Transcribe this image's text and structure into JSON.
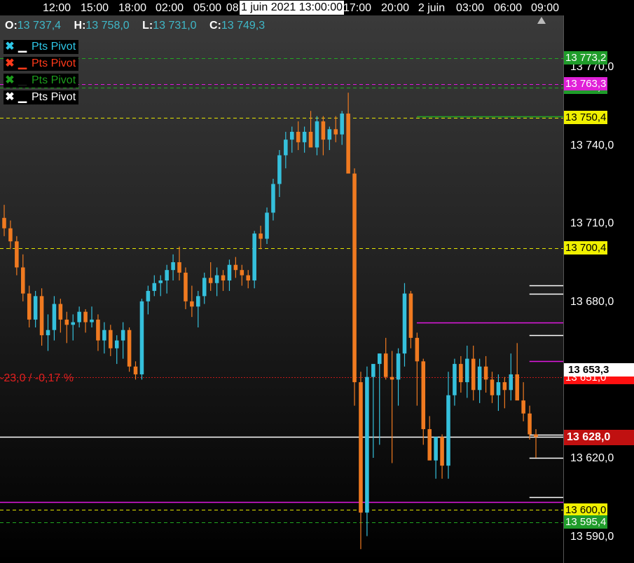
{
  "time_axis": {
    "labels": [
      "12:00",
      "15:00",
      "18:00",
      "02:00",
      "05:00",
      "08:",
      "17:00",
      "20:00",
      "2 juin",
      "03:00",
      "06:00",
      "09:00"
    ],
    "cursor_label": "1 juin 2021 13:00:00"
  },
  "ohlc": {
    "o_label": "O:",
    "o_value": "13 737,4",
    "h_label": "H:",
    "h_value": "13 758,0",
    "l_label": "L:",
    "l_value": "13 731,0",
    "c_label": "C:",
    "c_value": "13 749,3"
  },
  "legend": [
    {
      "label": "Pts Pivot",
      "color": "#2ec8e8"
    },
    {
      "label": "Pts Pivot",
      "color": "#ff3a1a"
    },
    {
      "label": "Pts Pivot",
      "color": "#1c9c1c"
    },
    {
      "label": "Pts Pivot",
      "color": "#ffffff"
    }
  ],
  "change_label": "-23,0 / -0,17 %",
  "colors": {
    "up": "#35c0dc",
    "down": "#f07a20",
    "pivot_green": "#22a822",
    "pivot_yellow": "#e6e600",
    "pivot_magenta": "#e018e0",
    "change_red": "#e02020"
  },
  "price_axis": {
    "labels": [
      "13 770,0",
      "13 740,0",
      "13 710,0",
      "13 680,0",
      "13 620,0",
      "13 590,0"
    ],
    "tags": [
      {
        "text": "13 773,2",
        "bg": "#1f9c2a",
        "fg": "#ffffff",
        "price": 13773.2
      },
      {
        "text": "13 763,3",
        "bg": "#e020d8",
        "fg": "#ffffff",
        "price": 13763.3
      },
      {
        "text": "13 762,0",
        "bg": "#1f9c2a",
        "fg": "#ffffff",
        "price": 13762.0
      },
      {
        "text": "13 750,4",
        "bg": "#f0f000",
        "fg": "#000000",
        "price": 13750.4
      },
      {
        "text": "13 700,4",
        "bg": "#f0f000",
        "fg": "#000000",
        "price": 13700.4
      },
      {
        "text": "13 653,3",
        "bg": "#ffffff",
        "fg": "#000000",
        "price": 13653.3
      },
      {
        "text": "13 651,0",
        "bg": "#ff1010",
        "fg": "#ffffff",
        "price": 13651.0
      },
      {
        "text": "13 628,0",
        "bg": "#c01010",
        "fg": "#ffffff",
        "price": 13628.0
      },
      {
        "text": "13 600,0",
        "bg": "#f0f000",
        "fg": "#000000",
        "price": 13600.0
      },
      {
        "text": "13 595,4",
        "bg": "#1f9c2a",
        "fg": "#ffffff",
        "price": 13595.4
      }
    ]
  },
  "chart_data": {
    "type": "candlestick",
    "title": "",
    "ylim": [
      13587,
      13790
    ],
    "levels": [
      {
        "price": 13773.2,
        "color": "#22a822",
        "style": "dashed"
      },
      {
        "price": 13763.3,
        "color": "#e018e0",
        "style": "dashed"
      },
      {
        "price": 13762.0,
        "color": "#22a822",
        "style": "dashed"
      },
      {
        "price": 13750.4,
        "color": "#e6e600",
        "style": "dashed"
      },
      {
        "price": 13700.4,
        "color": "#e6e600",
        "style": "dashed"
      },
      {
        "price": 13651.0,
        "color": "#c01818",
        "style": "dotted"
      },
      {
        "price": 13628.0,
        "color": "#ffffff",
        "style": "solid"
      },
      {
        "price": 13603.0,
        "color": "#e018e0",
        "style": "solid"
      },
      {
        "price": 13600.0,
        "color": "#e6e600",
        "style": "dashed"
      },
      {
        "price": 13595.4,
        "color": "#22a822",
        "style": "dashed"
      }
    ],
    "segments": [
      {
        "price": 13751.0,
        "from": 0.74,
        "to": 1.0,
        "color": "#22a822"
      },
      {
        "price": 13672.0,
        "from": 0.74,
        "to": 1.0,
        "color": "#e018e0"
      },
      {
        "price": 13683.0,
        "from": 0.94,
        "to": 1.0,
        "color": "#ffffff"
      },
      {
        "price": 13657.0,
        "from": 0.94,
        "to": 1.0,
        "color": "#e018e0"
      },
      {
        "price": 13605.0,
        "from": 0.94,
        "to": 1.0,
        "color": "#ffffff"
      },
      {
        "price": 13686.0,
        "from": 0.94,
        "to": 1.0,
        "color": "#ffffff"
      },
      {
        "price": 13667.0,
        "from": 0.94,
        "to": 1.0,
        "color": "#ffffff"
      },
      {
        "price": 13629.0,
        "from": 0.94,
        "to": 1.0,
        "color": "#ffffff"
      },
      {
        "price": 13620.0,
        "from": 0.94,
        "to": 1.0,
        "color": "#ffffff"
      }
    ],
    "candles": [
      [
        13712,
        13717,
        13705,
        13708
      ],
      [
        13708,
        13711,
        13700,
        13703
      ],
      [
        13703,
        13705,
        13690,
        13693
      ],
      [
        13693,
        13698,
        13680,
        13683
      ],
      [
        13683,
        13686,
        13670,
        13673
      ],
      [
        13673,
        13684,
        13670,
        13682
      ],
      [
        13682,
        13685,
        13663,
        13667
      ],
      [
        13667,
        13675,
        13661,
        13669
      ],
      [
        13669,
        13682,
        13665,
        13679
      ],
      [
        13679,
        13681,
        13668,
        13673
      ],
      [
        13673,
        13676,
        13664,
        13671
      ],
      [
        13671,
        13675,
        13665,
        13672
      ],
      [
        13672,
        13678,
        13670,
        13676
      ],
      [
        13676,
        13677,
        13668,
        13672
      ],
      [
        13672,
        13678,
        13670,
        13673
      ],
      [
        13673,
        13675,
        13661,
        13665
      ],
      [
        13665,
        13672,
        13660,
        13669
      ],
      [
        13669,
        13671,
        13659,
        13662
      ],
      [
        13662,
        13667,
        13656,
        13665
      ],
      [
        13665,
        13672,
        13658,
        13669
      ],
      [
        13669,
        13670,
        13653,
        13655
      ],
      [
        13655,
        13657,
        13650,
        13652
      ],
      [
        13652,
        13681,
        13650,
        13680
      ],
      [
        13680,
        13686,
        13675,
        13684
      ],
      [
        13684,
        13690,
        13682,
        13687
      ],
      [
        13687,
        13690,
        13682,
        13688
      ],
      [
        13688,
        13694,
        13683,
        13692
      ],
      [
        13692,
        13698,
        13688,
        13695
      ],
      [
        13695,
        13701,
        13688,
        13691
      ],
      [
        13691,
        13693,
        13677,
        13680
      ],
      [
        13680,
        13686,
        13674,
        13678
      ],
      [
        13678,
        13684,
        13670,
        13682
      ],
      [
        13682,
        13691,
        13679,
        13689
      ],
      [
        13689,
        13695,
        13684,
        13687
      ],
      [
        13687,
        13693,
        13682,
        13690
      ],
      [
        13690,
        13692,
        13684,
        13688
      ],
      [
        13688,
        13696,
        13684,
        13694
      ],
      [
        13694,
        13697,
        13689,
        13692
      ],
      [
        13692,
        13694,
        13686,
        13690
      ],
      [
        13690,
        13692,
        13685,
        13688
      ],
      [
        13688,
        13707,
        13685,
        13706
      ],
      [
        13706,
        13709,
        13700,
        13704
      ],
      [
        13704,
        13716,
        13702,
        13714
      ],
      [
        13714,
        13727,
        13711,
        13725
      ],
      [
        13725,
        13738,
        13720,
        13736
      ],
      [
        13736,
        13745,
        13731,
        13742
      ],
      [
        13742,
        13747,
        13737,
        13745
      ],
      [
        13745,
        13749,
        13738,
        13741
      ],
      [
        13741,
        13747,
        13737,
        13745
      ],
      [
        13745,
        13753,
        13741,
        13739
      ],
      [
        13739,
        13751,
        13736,
        13749
      ],
      [
        13749,
        13751,
        13736,
        13742
      ],
      [
        13742,
        13747,
        13738,
        13746
      ],
      [
        13746,
        13751,
        13741,
        13744
      ],
      [
        13744,
        13753,
        13740,
        13752
      ],
      [
        13752,
        13760,
        13743,
        13729
      ],
      [
        13729,
        13731,
        13640,
        13649
      ],
      [
        13649,
        13653,
        13585,
        13599
      ],
      [
        13599,
        13655,
        13590,
        13651
      ],
      [
        13651,
        13653,
        13620,
        13656
      ],
      [
        13656,
        13660,
        13625,
        13660
      ],
      [
        13660,
        13666,
        13650,
        13651
      ],
      [
        13651,
        13661,
        13618,
        13650
      ],
      [
        13650,
        13662,
        13640,
        13660
      ],
      [
        13660,
        13687,
        13655,
        13683
      ],
      [
        13683,
        13684,
        13662,
        13666
      ],
      [
        13666,
        13668,
        13640,
        13657
      ],
      [
        13657,
        13658,
        13625,
        13631
      ],
      [
        13631,
        13636,
        13625,
        13619
      ],
      [
        13619,
        13624,
        13612,
        13628
      ],
      [
        13628,
        13629,
        13612,
        13617
      ],
      [
        13617,
        13653,
        13612,
        13644
      ],
      [
        13644,
        13658,
        13640,
        13656
      ],
      [
        13656,
        13659,
        13645,
        13649
      ],
      [
        13649,
        13663,
        13643,
        13658
      ],
      [
        13658,
        13663,
        13642,
        13646
      ],
      [
        13646,
        13658,
        13641,
        13655
      ],
      [
        13655,
        13659,
        13645,
        13650
      ],
      [
        13650,
        13653,
        13641,
        13644
      ],
      [
        13644,
        13652,
        13638,
        13649
      ],
      [
        13649,
        13651,
        13639,
        13646
      ],
      [
        13646,
        13660,
        13642,
        13652
      ],
      [
        13652,
        13664,
        13645,
        13642
      ],
      [
        13642,
        13649,
        13634,
        13637
      ],
      [
        13637,
        13640,
        13627,
        13629
      ],
      [
        13629,
        13631,
        13620,
        13628
      ]
    ]
  }
}
